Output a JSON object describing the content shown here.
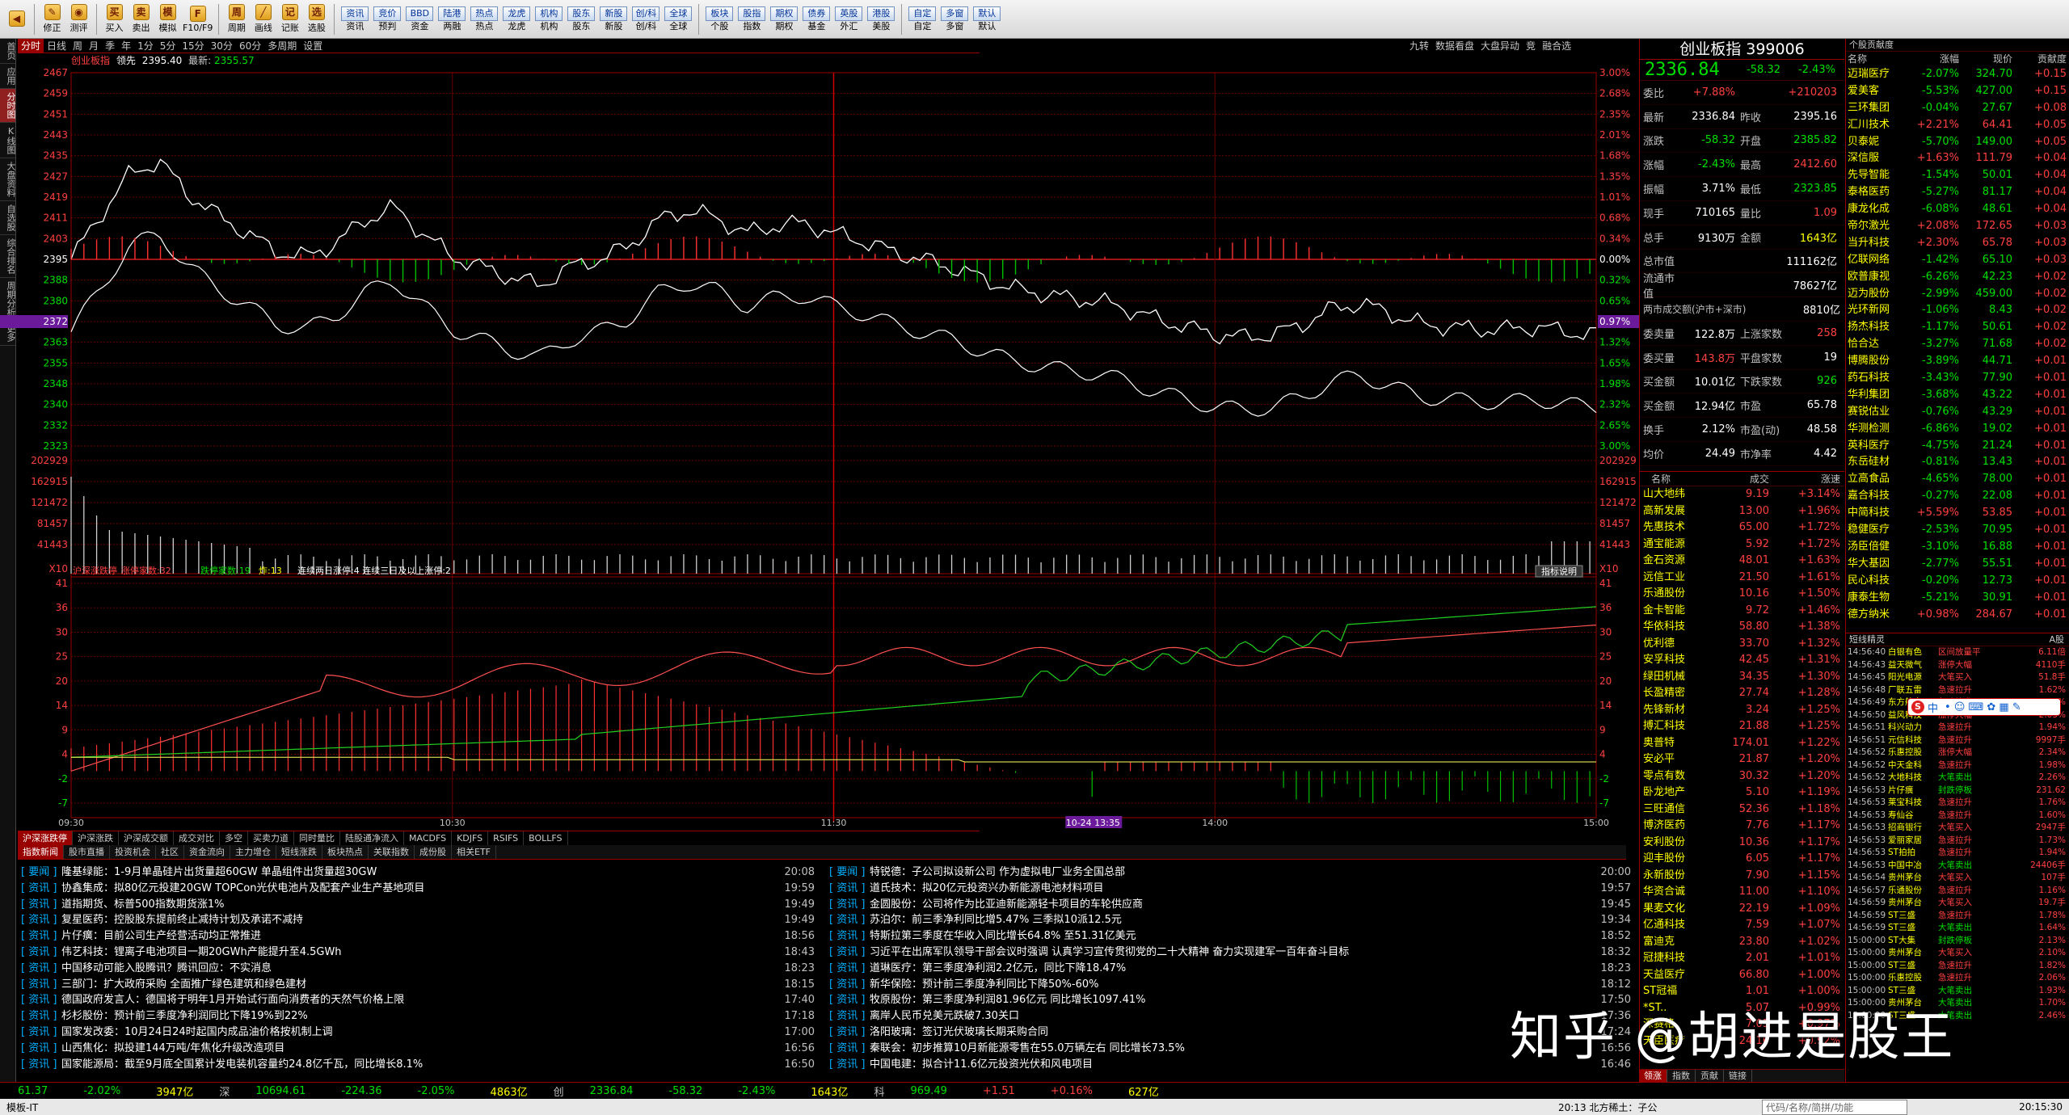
{
  "toolbar": {
    "items": [
      {
        "label": "",
        "icon": "back-arrow-icon",
        "glyph": "◀"
      },
      {
        "label": "修正",
        "icon": "fix-icon",
        "glyph": "✎"
      },
      {
        "label": "测评",
        "icon": "eval-icon",
        "glyph": "◉"
      },
      {
        "label": "买入",
        "icon": "buy-icon",
        "glyph": "买"
      },
      {
        "label": "卖出",
        "icon": "sell-icon",
        "glyph": "卖"
      },
      {
        "label": "模拟",
        "icon": "sim-icon",
        "glyph": "模"
      },
      {
        "label": "F10/F9",
        "icon": "f10-icon",
        "glyph": "F"
      },
      {
        "label": "周期",
        "icon": "period-icon",
        "glyph": "周"
      },
      {
        "label": "画线",
        "icon": "draw-line-icon",
        "glyph": "╱"
      },
      {
        "label": "记账",
        "icon": "ledger-icon",
        "glyph": "记"
      },
      {
        "label": "选股",
        "icon": "screen-stock-icon",
        "glyph": "选"
      }
    ],
    "squares": [
      {
        "top": "资讯",
        "bottom": "资讯"
      },
      {
        "top": "竞价",
        "bottom": "预判"
      },
      {
        "top": "BBD",
        "bottom": "资金"
      },
      {
        "top": "陆港",
        "bottom": "两融"
      },
      {
        "top": "热点",
        "bottom": "热点"
      },
      {
        "top": "龙虎",
        "bottom": "龙虎"
      },
      {
        "top": "机构",
        "bottom": "机构"
      },
      {
        "top": "股东",
        "bottom": "股东"
      },
      {
        "top": "新股",
        "bottom": "新股"
      },
      {
        "top": "创/科",
        "bottom": "创/科"
      },
      {
        "top": "全球",
        "bottom": "全球"
      },
      {
        "top": "板块",
        "bottom": "个股"
      },
      {
        "top": "股指",
        "bottom": "指数"
      },
      {
        "top": "期权",
        "bottom": "期权"
      },
      {
        "top": "债券",
        "bottom": "基金"
      },
      {
        "top": "英股",
        "bottom": "外汇"
      },
      {
        "top": "港股",
        "bottom": "美股"
      },
      {
        "top": "自定",
        "bottom": "自定"
      },
      {
        "top": "多窗",
        "bottom": "多窗"
      },
      {
        "top": "默认",
        "bottom": "默认"
      }
    ]
  },
  "leftnav": [
    "首页",
    "应用",
    "分时图",
    "K线图",
    "大盘资料",
    "自选股",
    "综合排名",
    "周期分析",
    "更多"
  ],
  "chart_tabs": [
    "分时",
    "日线",
    "周",
    "月",
    "季",
    "年",
    "1分",
    "5分",
    "15分",
    "30分",
    "60分",
    "多周期",
    "设置"
  ],
  "chart_tabs_right": [
    "九转",
    "数据看盘",
    "大盘异动",
    "竞",
    "融合选"
  ],
  "info": {
    "name": "创业板指",
    "state": "领先",
    "price_label": "2395.40",
    "latest_label": "最新:",
    "latest": "2355.57"
  },
  "chart_data": [
    {
      "type": "line",
      "title": "创业板指 分时",
      "y_ticks": [
        2467,
        2459,
        2451,
        2443,
        2435,
        2427,
        2419,
        2411,
        2403,
        2395,
        2388,
        2380,
        2372,
        2363,
        2355,
        2348,
        2340,
        2332,
        2323
      ],
      "pct_ticks": [
        "3.00%",
        "2.68%",
        "2.35%",
        "2.01%",
        "1.68%",
        "1.35%",
        "1.01%",
        "0.68%",
        "0.34%",
        "0.00%",
        "0.32%",
        "0.65%",
        "0.97%",
        "1.32%",
        "1.65%",
        "1.98%",
        "2.32%",
        "2.65%",
        "3.00%"
      ],
      "prev_close": 2395.16,
      "x_labels": [
        "09:30",
        "10:30",
        "11:30",
        "10-24 13:35",
        "14:00",
        "15:00"
      ],
      "series_price_approx": [
        2395,
        2412,
        2428,
        2433,
        2420,
        2412,
        2405,
        2398,
        2396,
        2401,
        2410,
        2415,
        2405,
        2396,
        2392,
        2388,
        2385,
        2392,
        2395,
        2400,
        2410,
        2414,
        2411,
        2405,
        2408,
        2409,
        2405,
        2402,
        2398,
        2395,
        2392,
        2388,
        2384,
        2382,
        2380,
        2379,
        2376,
        2372,
        2369,
        2366,
        2365,
        2366,
        2370,
        2376,
        2378,
        2374,
        2370,
        2369,
        2368,
        2368,
        2369,
        2367,
        2366
      ]
    },
    {
      "type": "bar",
      "title": "成交量",
      "y_ticks": [
        202929,
        162915,
        121472,
        81457,
        41443
      ],
      "unit": "X10"
    },
    {
      "type": "line",
      "title": "沪深涨跌停",
      "series": [
        {
          "name": "涨停家数",
          "value": 32
        },
        {
          "name": "跌停家数",
          "value": 19
        },
        {
          "name": "炸",
          "value": 13
        }
      ],
      "legend_text": "连续两日涨停:4 连续三日及以上涨停:2",
      "y_ticks": [
        41,
        36,
        30,
        25,
        20,
        14,
        9,
        4,
        -2,
        -7
      ],
      "button": "指标说明"
    }
  ],
  "quote": {
    "title": "创业板指 399006",
    "price": "2336.84",
    "chg": "-58.32",
    "pct": "-2.43%",
    "rows": [
      {
        "l": "委比",
        "v": "+7.88%",
        "vc": "up",
        "l2": "",
        "v2": "+210203",
        "v2c": "up"
      },
      {
        "l": "最新",
        "v": "2336.84",
        "vc": "wh",
        "l2": "昨收",
        "v2": "2395.16",
        "v2c": "wh"
      },
      {
        "l": "涨跌",
        "v": "-58.32",
        "vc": "dn",
        "l2": "开盘",
        "v2": "2385.82",
        "v2c": "dn"
      },
      {
        "l": "涨幅",
        "v": "-2.43%",
        "vc": "dn",
        "l2": "最高",
        "v2": "2412.60",
        "v2c": "up"
      },
      {
        "l": "振幅",
        "v": "3.71%",
        "vc": "wh",
        "l2": "最低",
        "v2": "2323.85",
        "v2c": "dn"
      },
      {
        "l": "现手",
        "v": "710165",
        "vc": "wh",
        "l2": "量比",
        "v2": "1.09",
        "v2c": "up"
      },
      {
        "l": "总手",
        "v": "9130万",
        "vc": "wh",
        "l2": "金额",
        "v2": "1643亿",
        "v2c": "yl"
      },
      {
        "l": "总市值",
        "v": "",
        "vc": "wh",
        "l2": "",
        "v2": "111162亿",
        "v2c": "wh"
      },
      {
        "l": "流通市值",
        "v": "",
        "vc": "wh",
        "l2": "",
        "v2": "78627亿",
        "v2c": "wh"
      },
      {
        "l": "两市成交额(沪市+深市)",
        "v": "",
        "vc": "wh",
        "l2": "",
        "v2": "8810亿",
        "v2c": "wh"
      },
      {
        "l": "委卖量",
        "v": "122.8万",
        "vc": "wh",
        "l2": "上涨家数",
        "v2": "258",
        "v2c": "up"
      },
      {
        "l": "委买量",
        "v": "143.8万",
        "vc": "up",
        "l2": "平盘家数",
        "v2": "19",
        "v2c": "wh"
      },
      {
        "l": "买金额",
        "v": "10.01亿",
        "vc": "wh",
        "l2": "下跌家数",
        "v2": "926",
        "v2c": "dn"
      },
      {
        "l": "买金额",
        "v": "12.94亿",
        "vc": "wh",
        "l2": "市盈",
        "v2": "65.78",
        "v2c": "wh"
      },
      {
        "l": "换手",
        "v": "2.12%",
        "vc": "wh",
        "l2": "市盈(动)",
        "v2": "48.58",
        "v2c": "wh"
      },
      {
        "l": "均价",
        "v": "24.49",
        "vc": "wh",
        "l2": "市净率",
        "v2": "4.42",
        "v2c": "wh"
      }
    ]
  },
  "sectors": {
    "headers": [
      "名称",
      "成交",
      "涨速"
    ],
    "rows": [
      [
        "山大地纬",
        "9.19",
        "+3.14%"
      ],
      [
        "高新发展",
        "13.00",
        "+1.96%"
      ],
      [
        "先惠技术",
        "65.00",
        "+1.72%"
      ],
      [
        "通宝能源",
        "5.92",
        "+1.72%"
      ],
      [
        "金石资源",
        "48.01",
        "+1.63%"
      ],
      [
        "远信工业",
        "21.50",
        "+1.61%"
      ],
      [
        "乐通股份",
        "10.16",
        "+1.50%"
      ],
      [
        "金卡智能",
        "9.72",
        "+1.46%"
      ],
      [
        "华依科技",
        "58.80",
        "+1.38%"
      ],
      [
        "优利德",
        "33.70",
        "+1.32%"
      ],
      [
        "安孚科技",
        "42.45",
        "+1.31%"
      ],
      [
        "绿田机械",
        "34.35",
        "+1.30%"
      ],
      [
        "长盈精密",
        "27.74",
        "+1.28%"
      ],
      [
        "先锋新材",
        "3.24",
        "+1.25%"
      ],
      [
        "搏汇科技",
        "21.88",
        "+1.25%"
      ],
      [
        "奥普特",
        "174.01",
        "+1.22%"
      ],
      [
        "安必平",
        "21.87",
        "+1.20%"
      ],
      [
        "零点有数",
        "30.32",
        "+1.20%"
      ],
      [
        "卧龙地产",
        "5.10",
        "+1.19%"
      ],
      [
        "三旺通信",
        "52.36",
        "+1.18%"
      ],
      [
        "博济医药",
        "7.76",
        "+1.17%"
      ],
      [
        "安利股份",
        "10.36",
        "+1.17%"
      ],
      [
        "迎丰股份",
        "6.05",
        "+1.17%"
      ],
      [
        "永新股份",
        "7.90",
        "+1.15%"
      ],
      [
        "华资合诚",
        "11.00",
        "+1.10%"
      ],
      [
        "果麦文化",
        "22.19",
        "+1.09%"
      ],
      [
        "亿通科技",
        "7.59",
        "+1.07%"
      ],
      [
        "富迪克",
        "23.80",
        "+1.02%"
      ],
      [
        "冠捷科技",
        "2.01",
        "+1.01%"
      ],
      [
        "天益医疗",
        "66.80",
        "+1.00%"
      ],
      [
        "ST冠福",
        "1.01",
        "+1.00%"
      ],
      [
        "*ST..",
        "5.07",
        "+0.99%"
      ],
      [
        "深赛格",
        "7.03",
        "+0.97%"
      ],
      [
        "天臣医疗",
        "24.16",
        "+0.92%"
      ]
    ],
    "tabs": [
      "领涨",
      "指数",
      "贡献",
      "链接"
    ]
  },
  "stocklist": {
    "title": "个股贡献度",
    "headers": [
      "名称",
      "涨幅",
      "现价",
      "贡献度"
    ],
    "rows": [
      [
        "迈瑞医疗",
        "-2.07%",
        "324.70",
        "+0.15"
      ],
      [
        "爱美客",
        "-5.53%",
        "427.00",
        "+0.15"
      ],
      [
        "三环集团",
        "-0.04%",
        "27.67",
        "+0.08"
      ],
      [
        "汇川技术",
        "+2.21%",
        "64.41",
        "+0.05"
      ],
      [
        "贝泰妮",
        "-5.70%",
        "149.00",
        "+0.05"
      ],
      [
        "深信服",
        "+1.63%",
        "111.79",
        "+0.04"
      ],
      [
        "先导智能",
        "-1.54%",
        "50.01",
        "+0.04"
      ],
      [
        "泰格医药",
        "-5.27%",
        "81.17",
        "+0.04"
      ],
      [
        "康龙化成",
        "-6.08%",
        "48.61",
        "+0.04"
      ],
      [
        "帝尔激光",
        "+2.08%",
        "172.65",
        "+0.03"
      ],
      [
        "当升科技",
        "+2.30%",
        "65.78",
        "+0.03"
      ],
      [
        "亿联网络",
        "-1.42%",
        "65.10",
        "+0.03"
      ],
      [
        "欧普康视",
        "-6.26%",
        "42.23",
        "+0.02"
      ],
      [
        "迈为股份",
        "-2.99%",
        "459.00",
        "+0.02"
      ],
      [
        "光环新网",
        "-1.06%",
        "8.43",
        "+0.02"
      ],
      [
        "扬杰科技",
        "-1.17%",
        "50.61",
        "+0.02"
      ],
      [
        "恰合达",
        "-3.27%",
        "71.68",
        "+0.02"
      ],
      [
        "博腾股份",
        "-3.89%",
        "44.71",
        "+0.01"
      ],
      [
        "药石科技",
        "-3.43%",
        "77.90",
        "+0.01"
      ],
      [
        "华利集团",
        "-3.68%",
        "43.22",
        "+0.01"
      ],
      [
        "赛锐估业",
        "-0.76%",
        "43.29",
        "+0.01"
      ],
      [
        "华测检测",
        "-6.86%",
        "19.02",
        "+0.01"
      ],
      [
        "英科医疗",
        "-4.75%",
        "21.24",
        "+0.01"
      ],
      [
        "东岳硅材",
        "-0.81%",
        "13.43",
        "+0.01"
      ],
      [
        "立高食品",
        "-4.65%",
        "78.00",
        "+0.01"
      ],
      [
        "嘉合科技",
        "-0.27%",
        "22.08",
        "+0.01"
      ],
      [
        "中简科技",
        "+5.59%",
        "53.85",
        "+0.01"
      ],
      [
        "稳健医疗",
        "-2.53%",
        "70.95",
        "+0.01"
      ],
      [
        "汤臣倍健",
        "-3.10%",
        "16.88",
        "+0.01"
      ],
      [
        "华大基因",
        "-2.77%",
        "55.51",
        "+0.01"
      ],
      [
        "民心科技",
        "-0.20%",
        "12.73",
        "+0.01"
      ],
      [
        "康泰生物",
        "-5.21%",
        "30.91",
        "+0.01"
      ],
      [
        "德方纳米",
        "+0.98%",
        "284.67",
        "+0.01"
      ]
    ]
  },
  "flash": {
    "title": "短线精灵",
    "mode": "A股",
    "rows": [
      [
        "14:56:40",
        "白银有色",
        "区间放量平",
        "6.11倍"
      ],
      [
        "14:56:43",
        "益天微气",
        "涨停大幅",
        "4110手"
      ],
      [
        "14:56:45",
        "阳光电源",
        "大笔买入",
        "51.8手"
      ],
      [
        "14:56:48",
        "厂联五雷",
        "急速拉升",
        "1.62%"
      ],
      [
        "14:56:49",
        "东方航空",
        "急速拉升",
        "1.14%"
      ],
      [
        "14:56:50",
        "益风科技",
        "涨停大幅",
        "2.03%"
      ],
      [
        "14:56:51",
        "科兴动力",
        "急速拉升",
        "1.94%"
      ],
      [
        "14:56:51",
        "元信科技",
        "急速拉升",
        "9997手"
      ],
      [
        "14:56:52",
        "乐惠控股",
        "涨停大幅",
        "2.34%"
      ],
      [
        "14:56:52",
        "中天金科",
        "急速拉升",
        "1.98%"
      ],
      [
        "14:56:52",
        "大地科技",
        "大笔卖出",
        "2.26%"
      ],
      [
        "14:56:53",
        "片仔癀",
        "封跌停板",
        "231.62"
      ],
      [
        "14:56:53",
        "莱宝科技",
        "急速拉升",
        "1.76%"
      ],
      [
        "14:56:53",
        "寿仙谷",
        "急速拉升",
        "1.60%"
      ],
      [
        "14:56:53",
        "招商银行",
        "大笔买入",
        "2947手"
      ],
      [
        "14:56:53",
        "爱丽家居",
        "急速拉升",
        "1.73%"
      ],
      [
        "14:56:53",
        "ST拍拍",
        "急速拉升",
        "1.94%"
      ],
      [
        "14:56:53",
        "中国中冶",
        "大笔卖出",
        "24406手"
      ],
      [
        "14:56:54",
        "贵州茅台",
        "大笔买入",
        "107手"
      ],
      [
        "14:56:57",
        "乐通股份",
        "急速拉升",
        "1.16%"
      ],
      [
        "14:56:59",
        "贵州茅台",
        "大笔买入",
        "19.7手"
      ],
      [
        "14:56:59",
        "ST三盛",
        "急速拉升",
        "1.78%"
      ],
      [
        "14:56:59",
        "ST三盛",
        "大笔卖出",
        "1.64%"
      ],
      [
        "15:00:00",
        "ST大集",
        "封跌停板",
        "2.13%"
      ],
      [
        "15:00:00",
        "贵州茅台",
        "大笔买入",
        "2.10%"
      ],
      [
        "15:00:00",
        "ST三盛",
        "急速拉升",
        "1.82%"
      ],
      [
        "15:00:00",
        "乐惠控股",
        "急速拉升",
        "2.06%"
      ],
      [
        "15:00:00",
        "ST三盛",
        "大笔卖出",
        "1.93%"
      ],
      [
        "15:00:00",
        "贵州茅台",
        "大笔卖出",
        "1.70%"
      ],
      [
        "15:00:00",
        "ST三盛",
        "大笔卖出",
        "2.46%"
      ]
    ]
  },
  "ime": {
    "label": "中"
  },
  "lowtabs": [
    "沪深涨跌停",
    "沪深涨跌",
    "沪深成交额",
    "成交对比",
    "多空",
    "买卖力道",
    "同时量比",
    "陆股通净流入",
    "MACDFS",
    "KDJFS",
    "RSIFS",
    "BOLLFS"
  ],
  "newstabs": [
    "指数新闻",
    "股市直播",
    "投资机会",
    "社区",
    "资金流向",
    "主力增仓",
    "短线涨跌",
    "板块热点",
    "关联指数",
    "成份股",
    "相关ETF"
  ],
  "news_left": [
    [
      "要闻",
      "隆基绿能：1-9月单晶硅片出货量超60GW 单晶组件出货量超30GW",
      "20:08"
    ],
    [
      "资讯",
      "协鑫集成：拟80亿元投建20GW TOPCon光伏电池片及配套产业生产基地项目",
      "19:59"
    ],
    [
      "资讯",
      "道指期货、标普500指数期货涨1%",
      "19:49"
    ],
    [
      "资讯",
      "复星医药：控股股东提前终止减持计划及承诺不减持",
      "19:49"
    ],
    [
      "资讯",
      "片仔癀：目前公司生产经营活动均正常推进",
      "18:56"
    ],
    [
      "资讯",
      "伟艺科技：锂离子电池项目一期20GWh产能提升至4.5GWh",
      "18:43"
    ],
    [
      "资讯",
      "中国移动可能入股腾讯？腾讯回应：不实消息",
      "18:23"
    ],
    [
      "资讯",
      "三部门：扩大政府采购 全面推广绿色建筑和绿色建材",
      "18:15"
    ],
    [
      "资讯",
      "德国政府发言人：德国将于明年1月开始试行面向消费者的天然气价格上限",
      "17:40"
    ],
    [
      "资讯",
      "杉杉股份：预计前三季度净利润同比下降19%到22%",
      "17:18"
    ],
    [
      "资讯",
      "国家发改委：10月24日24时起国内成品油价格按机制上调",
      "17:00"
    ],
    [
      "资讯",
      "山西焦化：拟投建144万吨/年焦化升级改造项目",
      "16:56"
    ],
    [
      "资讯",
      "国家能源局：截至9月底全国累计发电装机容量约24.8亿千瓦，同比增长8.1%",
      "16:50"
    ]
  ],
  "news_right": [
    [
      "要闻",
      "特锐德：子公司拟设新公司 作为虚拟电厂业务全国总部",
      "20:00"
    ],
    [
      "资讯",
      "道氏技术：拟20亿元投资兴办新能源电池材料项目",
      "19:57"
    ],
    [
      "资讯",
      "金圆股份：公司将作为比亚迪新能源轻卡项目的车轮供应商",
      "19:45"
    ],
    [
      "资讯",
      "苏泊尔：前三季净利同比增5.47% 三季拟10派12.5元",
      "19:34"
    ],
    [
      "资讯",
      "特斯拉第三季度在华收入同比增长64.8% 至51.31亿美元",
      "18:52"
    ],
    [
      "资讯",
      "习近平在出席军队领导干部会议时强调 认真学习宣传贯彻党的二十大精神 奋力实现建军一百年奋斗目标",
      "18:32"
    ],
    [
      "资讯",
      "道琳医疗：第三季度净利润2.2亿元，同比下降18.47%",
      "18:23"
    ],
    [
      "资讯",
      "新华保险：预计前三季度净利同比下降50%-60%",
      "18:12"
    ],
    [
      "资讯",
      "牧原股份：第三季度净利润81.96亿元 同比增长1097.41%",
      "17:50"
    ],
    [
      "资讯",
      "离岸人民币兑美元跌破7.30关口",
      "17:36"
    ],
    [
      "资讯",
      "洛阳玻璃：签订光伏玻璃长期采购合同",
      "17:24"
    ],
    [
      "资讯",
      "秦联会：初步推算10月新能源零售在55.0万辆左右 同比增长73.5%",
      "16:56"
    ],
    [
      "资讯",
      "中国电建：拟合计11.6亿元投资光伏和风电项目",
      "16:46"
    ]
  ],
  "status": {
    "items": [
      {
        "t": "61.37",
        "c": "dn"
      },
      {
        "t": "-2.02%",
        "c": "dn"
      },
      {
        "t": "3947亿",
        "c": "yl"
      },
      {
        "t": "深",
        "c": "gy"
      },
      {
        "t": "10694.61",
        "c": "dn"
      },
      {
        "t": "-224.36",
        "c": "dn"
      },
      {
        "t": "-2.05%",
        "c": "dn"
      },
      {
        "t": "4863亿",
        "c": "yl"
      },
      {
        "t": "创",
        "c": "gy"
      },
      {
        "t": "2336.84",
        "c": "dn"
      },
      {
        "t": "-58.32",
        "c": "dn"
      },
      {
        "t": "-2.43%",
        "c": "dn"
      },
      {
        "t": "1643亿",
        "c": "yl"
      },
      {
        "t": "科",
        "c": "gy"
      },
      {
        "t": "969.49",
        "c": "dn"
      },
      {
        "t": "+1.51",
        "c": "up"
      },
      {
        "t": "+0.16%",
        "c": "up"
      },
      {
        "t": "627亿",
        "c": "yl"
      }
    ],
    "bottom_left": "模板-IT",
    "bottom_mid": "20:13 北方稀土：子公",
    "search": "代码/名称/简拼/功能",
    "clock": "20:15:30"
  },
  "watermark": "知乎 @胡进是股王"
}
